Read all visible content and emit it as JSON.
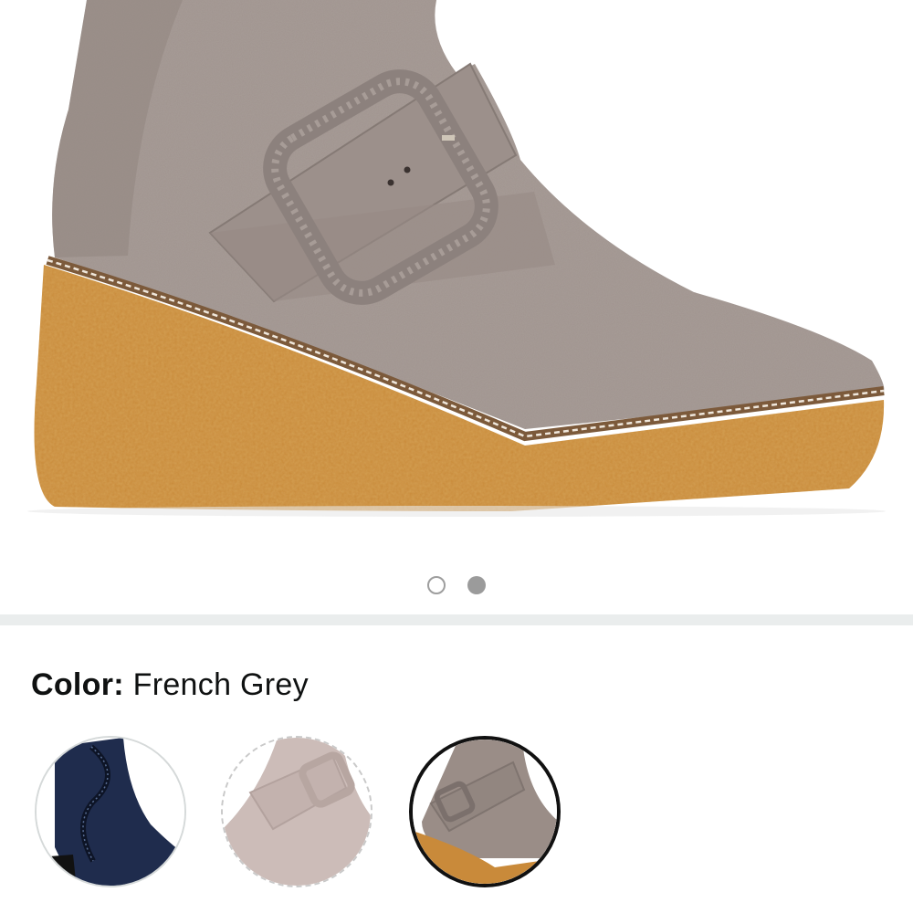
{
  "product": {
    "image_alt": "Grey suede wedge bootie with buckle strap"
  },
  "carousel": {
    "dots": [
      "empty",
      "filled"
    ]
  },
  "variation": {
    "label": "Color:",
    "value": "French Grey",
    "swatches": [
      {
        "name": "navy-swatch",
        "color": "#1f2c4d"
      },
      {
        "name": "blush-swatch",
        "color": "#ccbcb8"
      },
      {
        "name": "french-grey-swatch",
        "color": "#9a8d87",
        "selected": true
      }
    ]
  }
}
